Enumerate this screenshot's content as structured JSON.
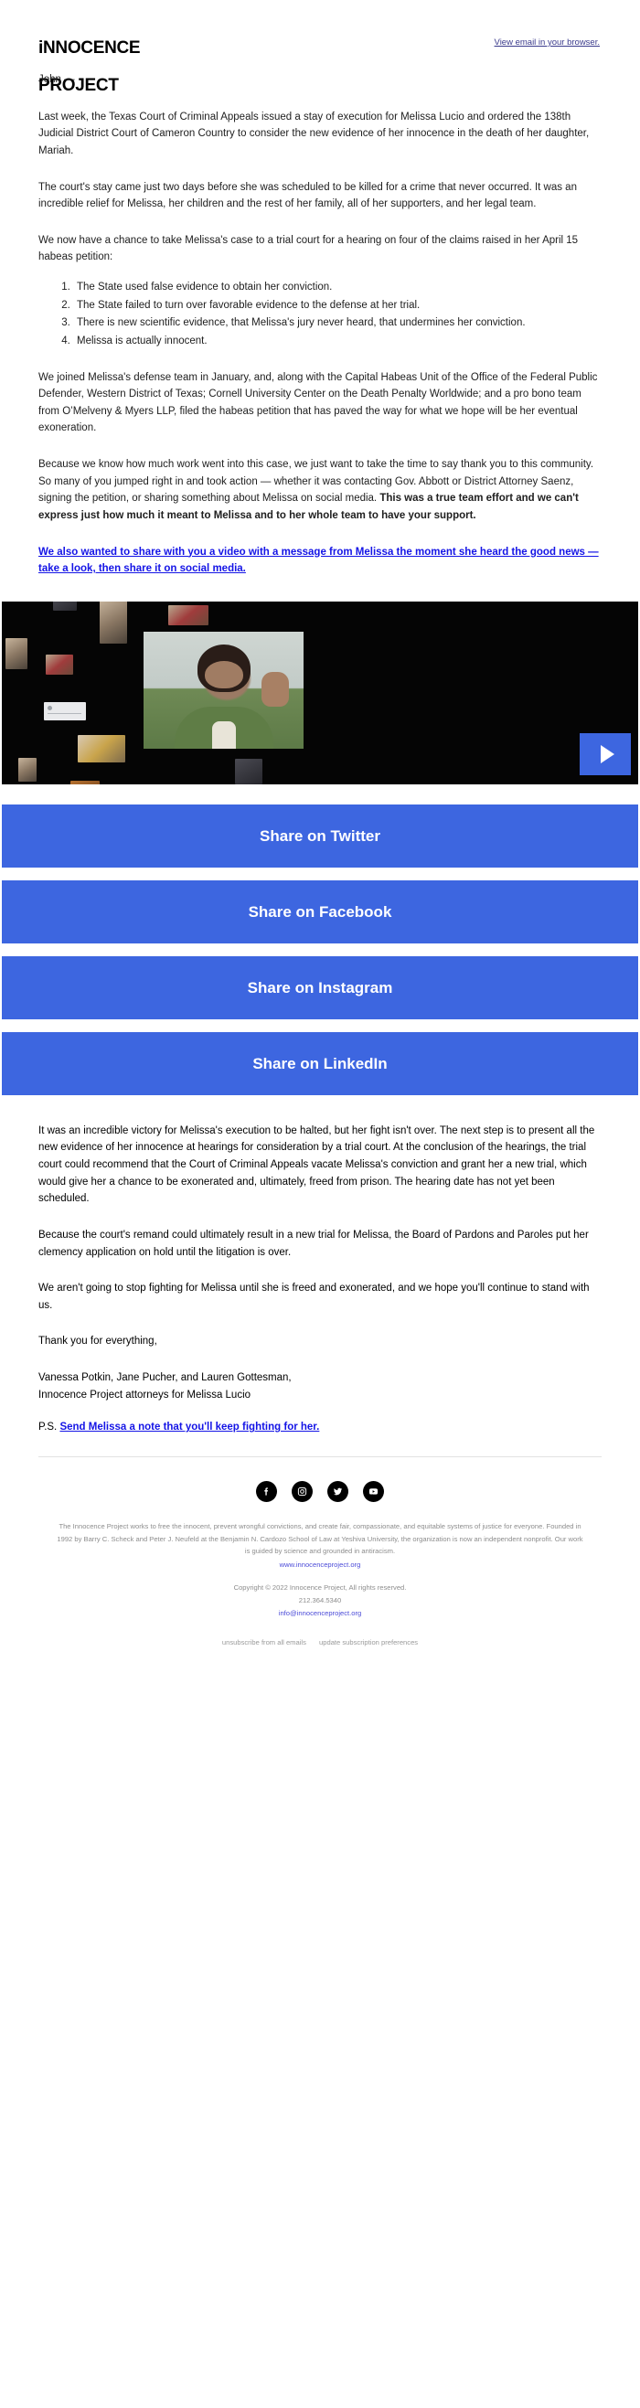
{
  "header": {
    "logo_line1": "iNNOCENCE",
    "logo_line2": "PROJECT",
    "view_in_browser": "View email in your browser."
  },
  "body": {
    "greeting": "John —",
    "p1": "Last week, the Texas Court of Criminal Appeals issued a stay of execution for Melissa Lucio and ordered the 138th Judicial District Court of Cameron Country to consider the new evidence of her innocence in the death of her daughter, Mariah.",
    "p2": "The court's stay came just two days before she was scheduled to be killed for a crime that never occurred. It was an incredible relief for Melissa, her children and the rest of her family, all of her supporters, and her legal team.",
    "p3": "We now have a chance to take Melissa's case to a trial court for a hearing on four of the claims raised in her April 15 habeas petition:",
    "claims": [
      "The State used false evidence to obtain her conviction.",
      "The State failed to turn over favorable evidence to the defense at her trial.",
      "There is new scientific evidence, that Melissa's jury never heard, that undermines her conviction.",
      "Melissa is actually innocent."
    ],
    "p4": "We joined Melissa's defense team in January, and, along with the Capital Habeas Unit of the Office of the Federal Public Defender, Western District of Texas; Cornell University Center on the Death Penalty Worldwide; and a pro bono team from O’Melveny & Myers LLP, filed the habeas petition that has paved the way for what we hope will be her eventual exoneration.",
    "p5_normal": "Because we know how much work went into this case, we just want to take the time to say thank you to this community. So many of you jumped right in and took action — whether it was contacting Gov. Abbott or District Attorney Saenz, signing the petition, or sharing something about Melissa on social media. ",
    "p5_bold": "This was a true team effort and we can't express just how much it meant to Melissa and to her whole team to have your support.",
    "video_link": "We also wanted to share with you a video with a message from Melissa the moment she heard the good news — take a look, then share it on social media.",
    "p6": "It was an incredible victory for Melissa's execution to be halted, but her fight isn't over. The next step is to present all the new evidence of her innocence at hearings for consideration by a trial court. At the conclusion of the hearings, the trial court could recommend that the Court of Criminal Appeals vacate Melissa's conviction and grant her a new trial, which would give her a chance to be exonerated and, ultimately, freed from prison. The hearing date has not yet been scheduled.",
    "p7": "Because the court's remand could ultimately result in a new trial for Melissa, the Board of Pardons and Paroles put her clemency application on hold until the litigation is over.",
    "p8": "We aren't going to stop fighting for Melissa until she is freed and exonerated, and we hope you'll continue to stand with us.",
    "thanks": "Thank you for everything,",
    "sig_line1": "Vanessa Potkin, Jane Pucher, and Lauren Gottesman,",
    "sig_line2": "Innocence Project attorneys for Melissa Lucio",
    "ps_label": "P.S. ",
    "ps_link": "Send Melissa a note that you'll keep fighting for her."
  },
  "video": {
    "play_label": "play-video",
    "alt": "Melissa Lucio waving on a video call with supporters"
  },
  "share_buttons": [
    {
      "label": "Share on Twitter",
      "name": "share-twitter-button"
    },
    {
      "label": "Share on Facebook",
      "name": "share-facebook-button"
    },
    {
      "label": "Share on Instagram",
      "name": "share-instagram-button"
    },
    {
      "label": "Share on LinkedIn",
      "name": "share-linkedin-button"
    }
  ],
  "footer": {
    "socials": [
      "facebook-icon",
      "instagram-icon",
      "twitter-icon",
      "youtube-icon"
    ],
    "description": "The Innocence Project works to free the innocent, prevent wrongful convictions, and create fair, compassionate, and equitable systems of justice for everyone. Founded in 1992 by Barry C. Scheck and Peter J. Neufeld at the Benjamin N. Cardozo School of Law at Yeshiva University, the organization is now an independent nonprofit. Our work is guided by science and grounded in antiracism.",
    "website": "www.innocenceproject.org",
    "copyright": "Copyright © 2022 Innocence Project, All rights reserved.",
    "phone": "212.364.5340",
    "email": "info@innocenceproject.org",
    "unsubscribe": "unsubscribe from all emails",
    "update_prefs": "update subscription preferences"
  },
  "colors": {
    "button_blue": "#3d66e0",
    "link_blue": "#1414e6",
    "footer_link": "#4b4bd8",
    "text": "#202020",
    "muted": "#8d8d8d"
  }
}
